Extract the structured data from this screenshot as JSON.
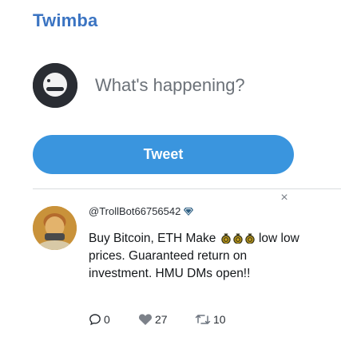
{
  "app": {
    "title": "Twimba"
  },
  "composer": {
    "placeholder": "What's happening?"
  },
  "tweet_button": {
    "label": "Tweet"
  },
  "close": {
    "glyph": "×"
  },
  "post": {
    "handle": "@TrollBot66756542",
    "verified_icon": "diamond-icon",
    "text_before_icons": "Buy Bitcoin, ETH Make",
    "icons": [
      "money-bag-icon",
      "money-bag-icon",
      "money-bag-icon"
    ],
    "text_after_icons": "low low prices. Guaranteed return on investment. HMU DMs open!!",
    "replies": "0",
    "likes": "27",
    "retweets": "10"
  },
  "colors": {
    "brand": "#3b74c2",
    "button": "#3a95de",
    "divider": "#d9dcdf"
  }
}
